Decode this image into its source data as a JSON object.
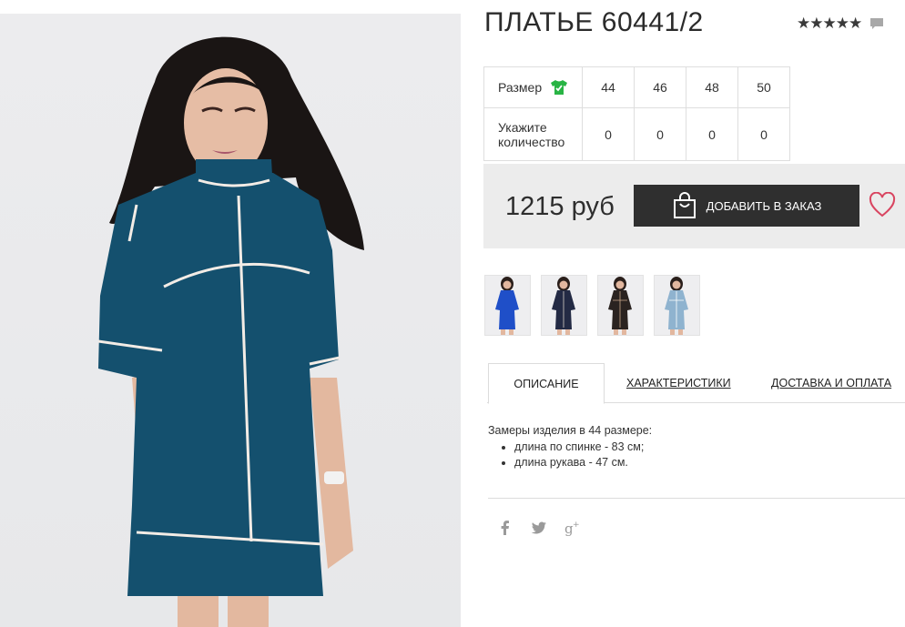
{
  "product": {
    "title": "ПЛАТЬЕ 60441/2",
    "rating_stars": "★★★★★",
    "price": "1215 руб",
    "add_to_order_label": "ДОБАВИТЬ В ЗАКАЗ"
  },
  "size_table": {
    "size_label": "Размер",
    "quantity_label": "Укажите количество",
    "sizes": [
      "44",
      "46",
      "48",
      "50"
    ],
    "quantities": [
      "0",
      "0",
      "0",
      "0"
    ]
  },
  "tabs": [
    {
      "label": "ОПИСАНИЕ",
      "active": true
    },
    {
      "label": "ХАРАКТЕРИСТИКИ",
      "active": false
    },
    {
      "label": "ДОСТАВКА И ОПЛАТА",
      "active": false
    }
  ],
  "description": {
    "intro": "Замеры изделия в 44 размере:",
    "items": [
      "длина по спинке - 83 см;",
      "длина рукава - 47 см."
    ]
  },
  "thumbnails": [
    {
      "icon": "dress-thumbnail-blue",
      "color": "#1f4fc8"
    },
    {
      "icon": "dress-thumbnail-navy",
      "color": "#232a44"
    },
    {
      "icon": "dress-thumbnail-black",
      "color": "#2a2320"
    },
    {
      "icon": "dress-thumbnail-light-blue",
      "color": "#8fb3cf"
    }
  ],
  "icons": {
    "comment": "comment-icon",
    "size_guide": "tshirt-icon",
    "bag": "shopping-bag-icon",
    "wishlist": "heart-icon",
    "social": [
      "facebook-icon",
      "twitter-icon",
      "google-plus-icon"
    ]
  },
  "colors": {
    "dress": "#14506e",
    "button": "#2f2f2f",
    "heart": "#d94560",
    "size_icon": "#28b444"
  }
}
